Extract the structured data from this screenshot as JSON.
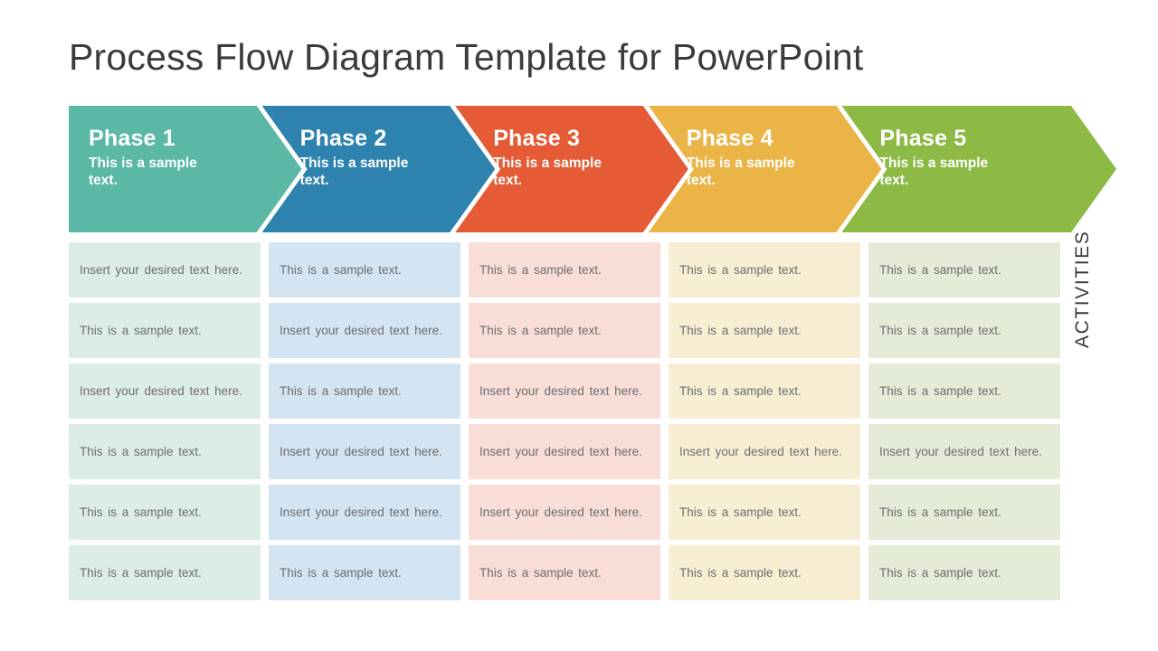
{
  "slide": {
    "title": "Process Flow Diagram Template for PowerPoint",
    "background": "#ffffff"
  },
  "phases": [
    {
      "title": "Phase 1",
      "subtitle": "This is a sample text.",
      "color": "#5BB8A6",
      "shape": "chevron-start"
    },
    {
      "title": "Phase 2",
      "subtitle": "This is a sample text.",
      "color": "#2E83AE",
      "shape": "chevron-notched"
    },
    {
      "title": "Phase 3",
      "subtitle": "This is a sample text.",
      "color": "#E45B35",
      "shape": "chevron-notched"
    },
    {
      "title": "Phase 4",
      "subtitle": "This is a sample text.",
      "color": "#EAB447",
      "shape": "chevron-notched"
    },
    {
      "title": "Phase 5",
      "subtitle": "This is a sample text.",
      "color": "#8CBA45",
      "shape": "chevron-notched-arrow-end"
    }
  ],
  "activities": {
    "axis_label": "ACTIVITIES",
    "column_colors": [
      "#DCEDE5",
      "#D3E4F2",
      "#F9DDD7",
      "#F7EED4",
      "#E4EBD7"
    ],
    "text_color": "#6d6d6d",
    "rows": [
      [
        "Insert your desired text here.",
        "This is a sample text.",
        "This is a sample text.",
        "This is a sample text.",
        "This is a sample text."
      ],
      [
        "This is a sample text.",
        "Insert your desired text here.",
        "This is a sample text.",
        "This is a sample text.",
        "This is a sample text."
      ],
      [
        "Insert your desired text here.",
        "This is a sample text.",
        "Insert your desired text here.",
        "This is a sample text.",
        "This is a sample text."
      ],
      [
        "This is a sample text.",
        "Insert your desired text here.",
        "Insert your desired text here.",
        "Insert your desired text here.",
        "Insert your desired text here."
      ],
      [
        "This is a sample text.",
        "Insert your desired text here.",
        "Insert your desired text here.",
        "This is a sample text.",
        "This is a sample text."
      ],
      [
        "This is a sample text.",
        "This is a sample text.",
        "This is a sample text.",
        "This is a sample text.",
        "This is a sample text."
      ]
    ]
  }
}
